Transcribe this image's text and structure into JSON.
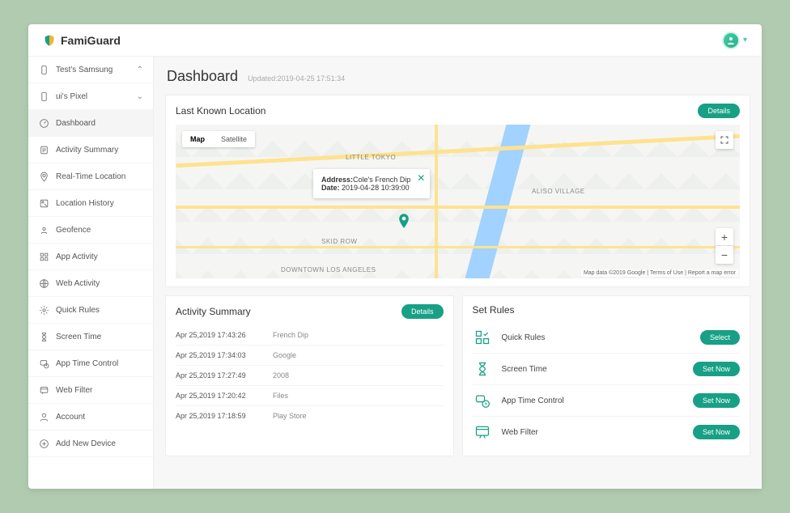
{
  "brand": "FamiGuard",
  "devices": [
    {
      "label": "Test's Samsung",
      "expanded": true
    },
    {
      "label": "ui's Pixel",
      "expanded": false
    }
  ],
  "nav": [
    {
      "id": "dashboard",
      "label": "Dashboard",
      "icon": "dashboard-icon",
      "active": true
    },
    {
      "id": "activity-summary",
      "label": "Activity Summary",
      "icon": "list-icon"
    },
    {
      "id": "real-time-location",
      "label": "Real-Time Location",
      "icon": "pin-icon"
    },
    {
      "id": "location-history",
      "label": "Location History",
      "icon": "history-icon"
    },
    {
      "id": "geofence",
      "label": "Geofence",
      "icon": "geofence-icon"
    },
    {
      "id": "app-activity",
      "label": "App Activity",
      "icon": "apps-icon"
    },
    {
      "id": "web-activity",
      "label": "Web Activity",
      "icon": "globe-icon"
    },
    {
      "id": "quick-rules",
      "label": "Quick Rules",
      "icon": "gear-icon"
    },
    {
      "id": "screen-time",
      "label": "Screen Time",
      "icon": "hourglass-icon"
    },
    {
      "id": "app-time-control",
      "label": "App Time Control",
      "icon": "app-time-icon"
    },
    {
      "id": "web-filter",
      "label": "Web Filter",
      "icon": "filter-icon"
    },
    {
      "id": "account",
      "label": "Account",
      "icon": "user-icon"
    },
    {
      "id": "add-new-device",
      "label": "Add New Device",
      "icon": "plus-icon"
    }
  ],
  "page": {
    "title": "Dashboard",
    "updated": "Updated:2019-04-25 17:51:34"
  },
  "location_card": {
    "title": "Last Known Location",
    "details_btn": "Details",
    "map": {
      "map_tab": "Map",
      "sat_tab": "Satellite",
      "attribution": "Map data ©2019 Google | Terms of Use | Report a map error",
      "labels": {
        "littletokyo": "LITTLE TOKYO",
        "skidrow": "SKID ROW",
        "downtown": "DOWNTOWN LOS ANGELES",
        "aliso": "ALISO VILLAGE"
      },
      "info_address_label": "Address:",
      "info_address": "Cole's French Dip",
      "info_date_label": "Date:",
      "info_date": "2019-04-28 10:39:00"
    }
  },
  "activity_card": {
    "title": "Activity Summary",
    "details_btn": "Details",
    "rows": [
      {
        "time": "Apr 25,2019 17:43:26",
        "desc": "French Dip"
      },
      {
        "time": "Apr 25,2019 17:34:03",
        "desc": "Google"
      },
      {
        "time": "Apr 25,2019 17:27:49",
        "desc": "2008"
      },
      {
        "time": "Apr 25,2019 17:20:42",
        "desc": "Files"
      },
      {
        "time": "Apr 25,2019 17:18:59",
        "desc": "Play Store"
      }
    ]
  },
  "rules_card": {
    "title": "Set Rules",
    "rows": [
      {
        "label": "Quick Rules",
        "btn": "Select",
        "icon": "grid-check-icon"
      },
      {
        "label": "Screen Time",
        "btn": "Set Now",
        "icon": "hourglass-icon"
      },
      {
        "label": "App Time Control",
        "btn": "Set Now",
        "icon": "app-time-icon"
      },
      {
        "label": "Web Filter",
        "btn": "Set Now",
        "icon": "filter-icon"
      }
    ]
  }
}
